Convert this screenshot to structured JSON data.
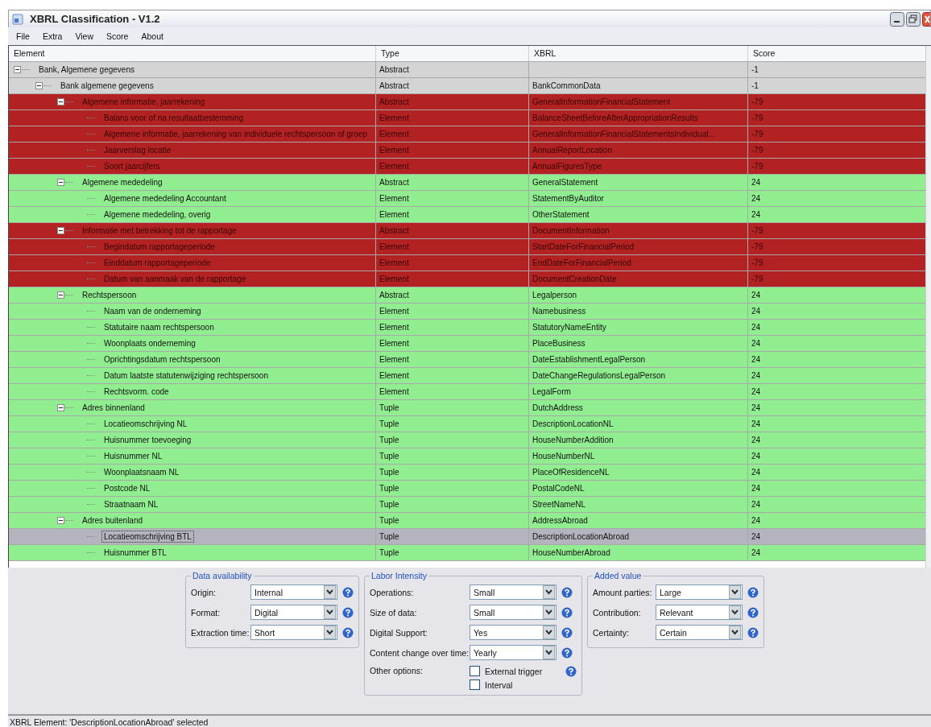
{
  "window": {
    "title": "XBRL Classification - V1.2"
  },
  "menu": [
    "File",
    "Extra",
    "View",
    "Score",
    "About"
  ],
  "columns": [
    "Element",
    "Type",
    "XBRL",
    "Score"
  ],
  "tree": [
    {
      "label": "Bank, Algemene gegevens",
      "type": "Abstract",
      "score": "-1",
      "color": "#d4d4d4",
      "selected": false,
      "expanded": true,
      "children": [
        {
          "label": "Bank algemene gegevens",
          "type": "Abstract",
          "xbrl": "BankCommonData",
          "score": "-1",
          "color": "#d4d4d4",
          "selected": false,
          "expanded": true,
          "children": [
            {
              "label": "Algemene informatie, jaarrekening",
              "type": "Abstract",
              "xbrl": "GeneralInformationFinancialStatement",
              "score": "-79",
              "color": "#b22222",
              "selected": false,
              "expanded": true,
              "children": [
                {
                  "label": "Balans voor of na resultaatbestemming",
                  "type": "Element",
                  "xbrl": "BalanceSheetBeforeAfterAppropriationResults",
                  "score": "-79",
                  "color": "#b22222",
                  "selected": false
                },
                {
                  "label": "Algemene informatie, jaarrekening van individuele rechtspersoon of groep",
                  "type": "Element",
                  "xbrl": "GeneralInformationFinancialStatementsIndividual...",
                  "score": "-79",
                  "color": "#b22222",
                  "selected": false
                },
                {
                  "label": "Jaarverslag locatie",
                  "type": "Element",
                  "xbrl": "AnnualReportLocation",
                  "score": "-79",
                  "color": "#b22222",
                  "selected": false
                },
                {
                  "label": "Soort jaarcijfers",
                  "type": "Element",
                  "xbrl": "AnnualFiguresType",
                  "score": "-79",
                  "color": "#b22222",
                  "selected": false
                }
              ]
            },
            {
              "label": "Algemene mededeling",
              "type": "Abstract",
              "xbrl": "GeneralStatement",
              "score": "24",
              "color": "#90ee90",
              "selected": false,
              "expanded": true,
              "children": [
                {
                  "label": "Algemene mededeling Accountant",
                  "type": "Element",
                  "xbrl": "StatementByAuditor",
                  "score": "24",
                  "color": "#90ee90",
                  "selected": false
                },
                {
                  "label": "Algemene mededeling, overig",
                  "type": "Element",
                  "xbrl": "OtherStatement",
                  "score": "24",
                  "color": "#90ee90",
                  "selected": false
                }
              ]
            },
            {
              "label": "Informatie met betrekking tot de rapportage",
              "type": "Abstract",
              "xbrl": "DocumentInformation",
              "score": "-79",
              "color": "#b22222",
              "selected": false,
              "expanded": true,
              "children": [
                {
                  "label": "Begindatum rapportageperiode",
                  "type": "Element",
                  "xbrl": "StartDateForFinancialPeriod",
                  "score": "-79",
                  "color": "#b22222",
                  "selected": false
                },
                {
                  "label": "Einddatum rapportageperiode",
                  "type": "Element",
                  "xbrl": "EndDateForFinancialPeriod",
                  "score": "-79",
                  "color": "#b22222",
                  "selected": false
                },
                {
                  "label": "Datum van aanmaak van de rapportage",
                  "type": "Element",
                  "xbrl": "DocumentCreationDate",
                  "score": "-79",
                  "color": "#b22222",
                  "selected": false
                }
              ]
            },
            {
              "label": "Rechtspersoon",
              "type": "Abstract",
              "xbrl": "Legalperson",
              "score": "24",
              "color": "#90ee90",
              "selected": false,
              "expanded": true,
              "children": [
                {
                  "label": "Naam van de onderneming",
                  "type": "Element",
                  "xbrl": "Namebusiness",
                  "score": "24",
                  "color": "#90ee90",
                  "selected": false
                },
                {
                  "label": "Statutaire naam rechtspersoon",
                  "type": "Element",
                  "xbrl": "StatutoryNameEntity",
                  "score": "24",
                  "color": "#90ee90",
                  "selected": false
                },
                {
                  "label": "Woonplaats onderneming",
                  "type": "Element",
                  "xbrl": "PlaceBusiness",
                  "score": "24",
                  "color": "#90ee90",
                  "selected": false
                },
                {
                  "label": "Oprichtingsdatum rechtspersoon",
                  "type": "Element",
                  "xbrl": "DateEstablishmentLegalPerson",
                  "score": "24",
                  "color": "#90ee90",
                  "selected": false
                },
                {
                  "label": "Datum laatste statutenwijziging rechtspersoon",
                  "type": "Element",
                  "xbrl": "DateChangeRegulationsLegalPerson",
                  "score": "24",
                  "color": "#90ee90",
                  "selected": false
                },
                {
                  "label": "Rechtsvorm. code",
                  "type": "Element",
                  "xbrl": "LegalForm",
                  "score": "24",
                  "color": "#90ee90",
                  "selected": false
                }
              ]
            },
            {
              "label": "Adres binnenland",
              "type": "Tuple",
              "xbrl": "DutchAddress",
              "score": "24",
              "color": "#90ee90",
              "selected": false,
              "expanded": true,
              "children": [
                {
                  "label": "Locatieomschrijving NL",
                  "type": "Tuple",
                  "xbrl": "DescriptionLocationNL",
                  "score": "24",
                  "color": "#90ee90",
                  "selected": false
                },
                {
                  "label": "Huisnummer toevoeging",
                  "type": "Tuple",
                  "xbrl": "HouseNumberAddition",
                  "score": "24",
                  "color": "#90ee90",
                  "selected": false
                },
                {
                  "label": "Huisnummer NL",
                  "type": "Tuple",
                  "xbrl": "HouseNumberNL",
                  "score": "24",
                  "color": "#90ee90",
                  "selected": false
                },
                {
                  "label": "Woonplaatsnaam NL",
                  "type": "Tuple",
                  "xbrl": "PlaceOfResidenceNL",
                  "score": "24",
                  "color": "#90ee90",
                  "selected": false
                },
                {
                  "label": "Postcode NL",
                  "type": "Tuple",
                  "xbrl": "PostalCodeNL",
                  "score": "24",
                  "color": "#90ee90",
                  "selected": false
                },
                {
                  "label": "Straatnaam NL",
                  "type": "Tuple",
                  "xbrl": "StreetNameNL",
                  "score": "24",
                  "color": "#90ee90",
                  "selected": false
                }
              ]
            },
            {
              "label": "Adres buitenland",
              "type": "Tuple",
              "xbrl": "AddressAbroad",
              "score": "24",
              "color": "#90ee90",
              "selected": false,
              "expanded": true,
              "children": [
                {
                  "label": "Locatieomschrijving BTL",
                  "type": "Tuple",
                  "xbrl": "DescriptionLocationAbroad",
                  "score": "24",
                  "selected": true
                },
                {
                  "label": "Huisnummer BTL",
                  "type": "Tuple",
                  "xbrl": "HouseNumberAbroad",
                  "score": "24",
                  "color": "#90ee90",
                  "selected": false
                }
              ]
            }
          ]
        }
      ]
    }
  ],
  "panels": [
    {
      "title": "Data availability",
      "fields": [
        {
          "kind": "select",
          "label": "Origin:",
          "value": "Internal"
        },
        {
          "kind": "select",
          "label": "Format:",
          "value": "Digital"
        },
        {
          "kind": "select",
          "label": "Extraction time:",
          "value": "Short"
        }
      ]
    },
    {
      "title": "Labor Intensity",
      "fields": [
        {
          "kind": "select",
          "label": "Operations:",
          "value": "Small"
        },
        {
          "kind": "select",
          "label": "Size of data:",
          "value": "Small"
        },
        {
          "kind": "select",
          "label": "Digital Support:",
          "value": "Yes"
        },
        {
          "kind": "select",
          "label": "Content change over time:",
          "value": "Yearly"
        },
        {
          "kind": "checkboxes",
          "label": "Other options:",
          "options": [
            {
              "label": "External trigger",
              "checked": false
            },
            {
              "label": "Interval",
              "checked": false
            }
          ]
        }
      ]
    },
    {
      "title": "Added value",
      "fields": [
        {
          "kind": "select",
          "label": "Amount parties:",
          "value": "Large"
        },
        {
          "kind": "select",
          "label": "Contribution:",
          "value": "Relevant"
        },
        {
          "kind": "select",
          "label": "Certainty:",
          "value": "Certain"
        }
      ]
    }
  ],
  "status_bar": "XBRL Element: 'DescriptionLocationAbroad' selected"
}
